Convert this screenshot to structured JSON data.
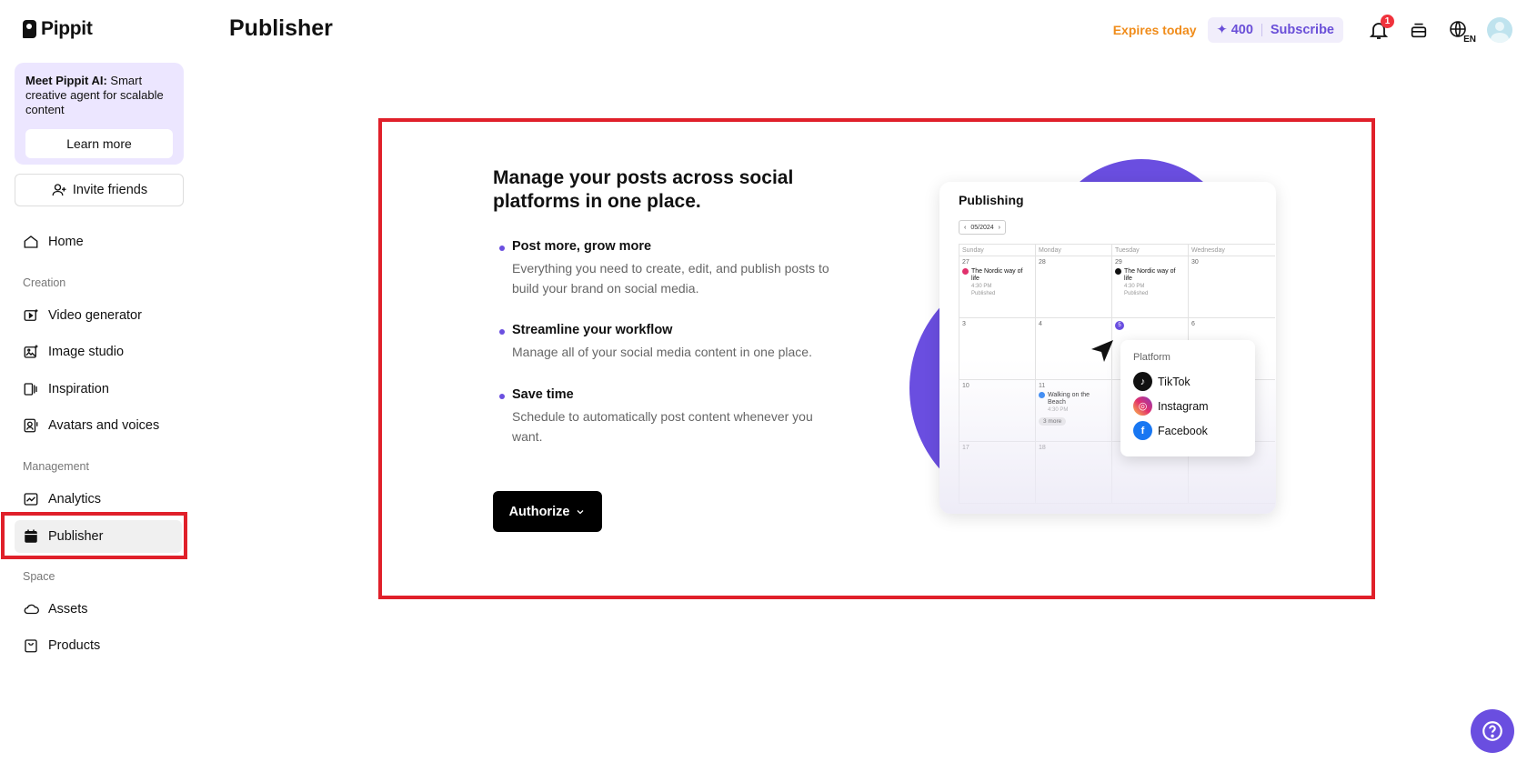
{
  "brand": {
    "name": "Pippit"
  },
  "sidebar": {
    "promo": {
      "title": "Meet Pippit AI:",
      "text": "Smart creative agent for scalable content",
      "button": "Learn more"
    },
    "invite": "Invite friends",
    "home": "Home",
    "sections": {
      "creation": "Creation",
      "management": "Management",
      "space": "Space"
    },
    "items": {
      "video_generator": "Video generator",
      "image_studio": "Image studio",
      "inspiration": "Inspiration",
      "avatars": "Avatars and voices",
      "analytics": "Analytics",
      "publisher": "Publisher",
      "assets": "Assets",
      "products": "Products"
    },
    "active_item": "Publisher"
  },
  "header": {
    "title": "Publisher",
    "expires": "Expires today",
    "credits": "400",
    "subscribe": "Subscribe",
    "notification_count": "1",
    "language": "EN"
  },
  "main": {
    "headline": "Manage your posts across social platforms in one place.",
    "features": [
      {
        "title": "Post more, grow more",
        "desc": "Everything you need to create, edit, and publish posts to build your brand on social media."
      },
      {
        "title": "Streamline your workflow",
        "desc": "Manage all of your social media content in one place."
      },
      {
        "title": "Save time",
        "desc": "Schedule to automatically post content whenever you want."
      }
    ],
    "authorize": "Authorize"
  },
  "illustration": {
    "title": "Publishing",
    "month": "05/2024",
    "weekdays": [
      "Sunday",
      "Monday",
      "Tuesday",
      "Wednesday"
    ],
    "rows": [
      [
        "27",
        "28",
        "29",
        "30"
      ],
      [
        "3",
        "4",
        "5",
        "6"
      ],
      [
        "10",
        "11",
        "",
        ""
      ],
      [
        "17",
        "18",
        "",
        ""
      ]
    ],
    "event_nordic": "The Nordic way of life",
    "event_time": "4:30 PM",
    "event_status": "Published",
    "event_beach": "Walking on the Beach",
    "more": "3 more",
    "platform": {
      "title": "Platform",
      "items": [
        "TikTok",
        "Instagram",
        "Facebook"
      ]
    }
  },
  "colors": {
    "accent": "#6a4ee0",
    "highlight": "#e0202a",
    "expires": "#f08c1a"
  }
}
